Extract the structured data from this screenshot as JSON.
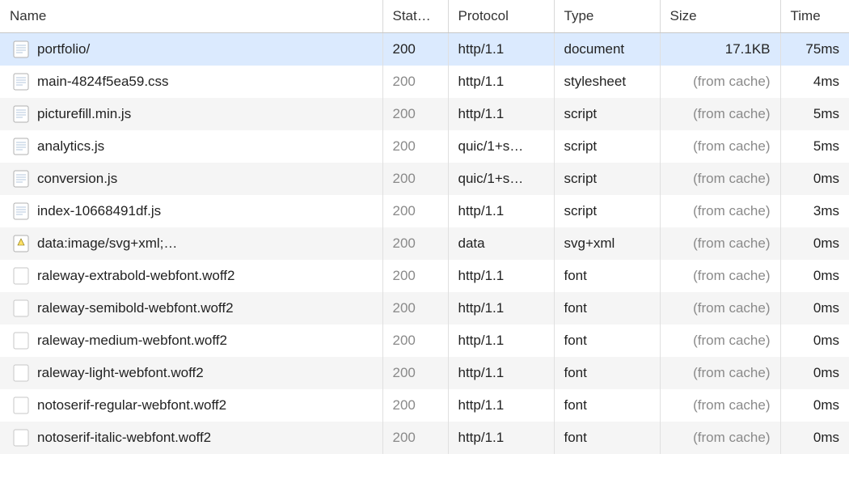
{
  "columns": {
    "name": "Name",
    "status": "Stat…",
    "protocol": "Protocol",
    "type": "Type",
    "size": "Size",
    "time": "Time"
  },
  "cache_label": "(from cache)",
  "rows": [
    {
      "name": "portfolio/",
      "status": "200",
      "protocol": "http/1.1",
      "type": "document",
      "size": "17.1KB",
      "time": "75ms",
      "icon": "doc",
      "selected": true,
      "status_muted": false,
      "size_cache": false
    },
    {
      "name": "main-4824f5ea59.css",
      "status": "200",
      "protocol": "http/1.1",
      "type": "stylesheet",
      "size": "(from cache)",
      "time": "4ms",
      "icon": "doc",
      "selected": false,
      "status_muted": true,
      "size_cache": true
    },
    {
      "name": "picturefill.min.js",
      "status": "200",
      "protocol": "http/1.1",
      "type": "script",
      "size": "(from cache)",
      "time": "5ms",
      "icon": "doc",
      "selected": false,
      "status_muted": true,
      "size_cache": true
    },
    {
      "name": "analytics.js",
      "status": "200",
      "protocol": "quic/1+s…",
      "type": "script",
      "size": "(from cache)",
      "time": "5ms",
      "icon": "doc",
      "selected": false,
      "status_muted": true,
      "size_cache": true
    },
    {
      "name": "conversion.js",
      "status": "200",
      "protocol": "quic/1+s…",
      "type": "script",
      "size": "(from cache)",
      "time": "0ms",
      "icon": "doc",
      "selected": false,
      "status_muted": true,
      "size_cache": true
    },
    {
      "name": "index-10668491df.js",
      "status": "200",
      "protocol": "http/1.1",
      "type": "script",
      "size": "(from cache)",
      "time": "3ms",
      "icon": "doc",
      "selected": false,
      "status_muted": true,
      "size_cache": true
    },
    {
      "name": "data:image/svg+xml;…",
      "status": "200",
      "protocol": "data",
      "type": "svg+xml",
      "size": "(from cache)",
      "time": "0ms",
      "icon": "svg",
      "selected": false,
      "status_muted": true,
      "size_cache": true
    },
    {
      "name": "raleway-extrabold-webfont.woff2",
      "status": "200",
      "protocol": "http/1.1",
      "type": "font",
      "size": "(from cache)",
      "time": "0ms",
      "icon": "font",
      "selected": false,
      "status_muted": true,
      "size_cache": true
    },
    {
      "name": "raleway-semibold-webfont.woff2",
      "status": "200",
      "protocol": "http/1.1",
      "type": "font",
      "size": "(from cache)",
      "time": "0ms",
      "icon": "font",
      "selected": false,
      "status_muted": true,
      "size_cache": true
    },
    {
      "name": "raleway-medium-webfont.woff2",
      "status": "200",
      "protocol": "http/1.1",
      "type": "font",
      "size": "(from cache)",
      "time": "0ms",
      "icon": "font",
      "selected": false,
      "status_muted": true,
      "size_cache": true
    },
    {
      "name": "raleway-light-webfont.woff2",
      "status": "200",
      "protocol": "http/1.1",
      "type": "font",
      "size": "(from cache)",
      "time": "0ms",
      "icon": "font",
      "selected": false,
      "status_muted": true,
      "size_cache": true
    },
    {
      "name": "notoserif-regular-webfont.woff2",
      "status": "200",
      "protocol": "http/1.1",
      "type": "font",
      "size": "(from cache)",
      "time": "0ms",
      "icon": "font",
      "selected": false,
      "status_muted": true,
      "size_cache": true
    },
    {
      "name": "notoserif-italic-webfont.woff2",
      "status": "200",
      "protocol": "http/1.1",
      "type": "font",
      "size": "(from cache)",
      "time": "0ms",
      "icon": "font",
      "selected": false,
      "status_muted": true,
      "size_cache": true
    }
  ]
}
